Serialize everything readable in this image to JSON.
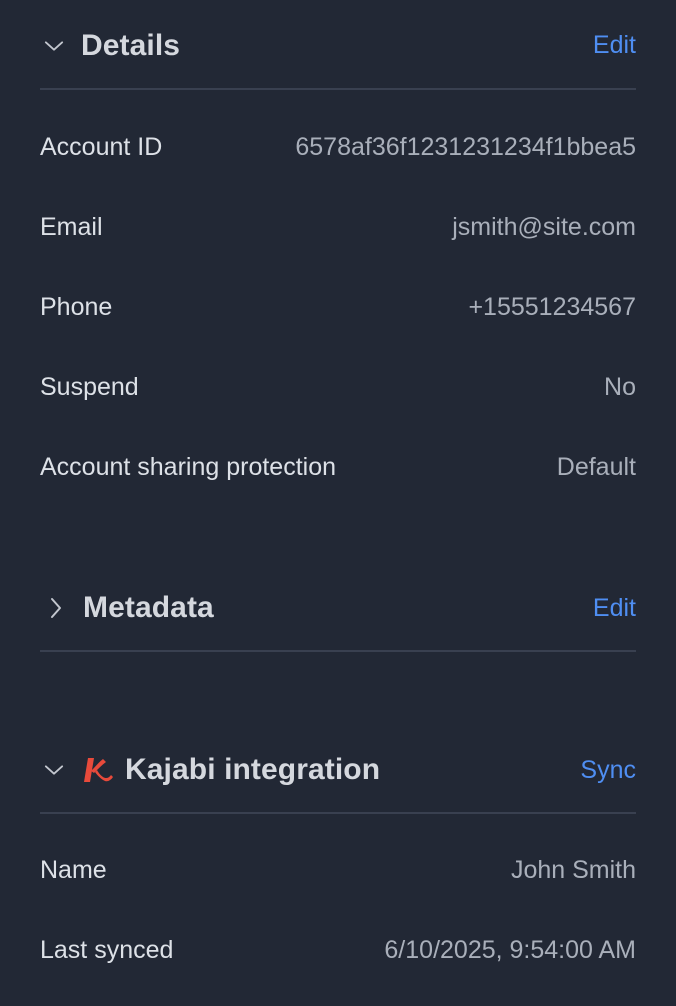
{
  "details": {
    "title": "Details",
    "action": "Edit",
    "rows": [
      {
        "label": "Account ID",
        "value": "6578af36f1231231234f1bbea5"
      },
      {
        "label": "Email",
        "value": "jsmith@site.com"
      },
      {
        "label": "Phone",
        "value": "+15551234567"
      },
      {
        "label": "Suspend",
        "value": "No"
      },
      {
        "label": "Account sharing protection",
        "value": "Default"
      }
    ]
  },
  "metadata": {
    "title": "Metadata",
    "action": "Edit"
  },
  "kajabi": {
    "title": "Kajabi integration",
    "action": "Sync",
    "logo_icon": "kajabi-logo-icon",
    "rows": [
      {
        "label": "Name",
        "value": "John Smith"
      },
      {
        "label": "Last synced",
        "value": "6/10/2025, 9:54:00 AM"
      }
    ]
  },
  "colors": {
    "background": "#222835",
    "accent": "#4f8ef2",
    "divider": "#394050",
    "logo": "#e84a3b"
  }
}
